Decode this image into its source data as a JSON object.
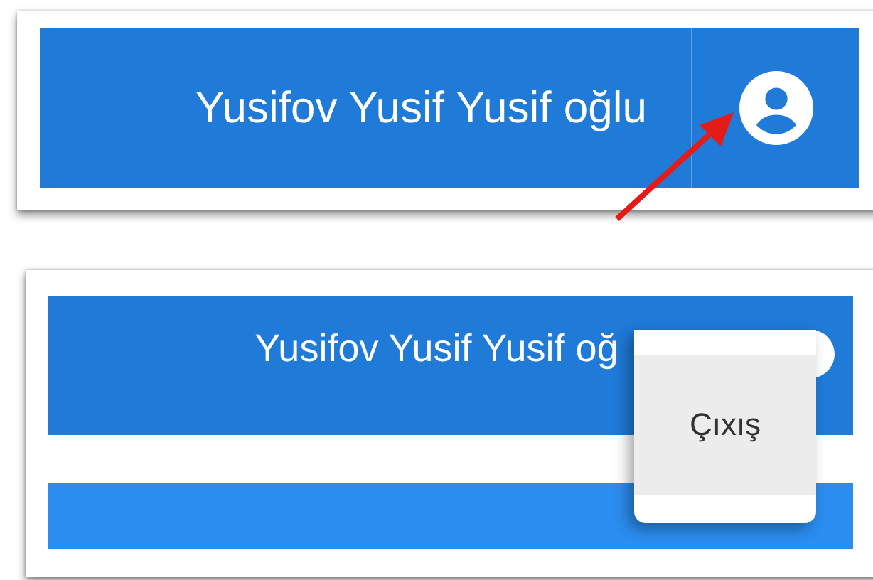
{
  "before": {
    "user_name": "Yusifov Yusif Yusif oğlu"
  },
  "after": {
    "user_name": "Yusifov Yusif Yusif oğ",
    "menu_open": true,
    "menu_items": [
      {
        "label": "Çıxış"
      }
    ]
  }
}
